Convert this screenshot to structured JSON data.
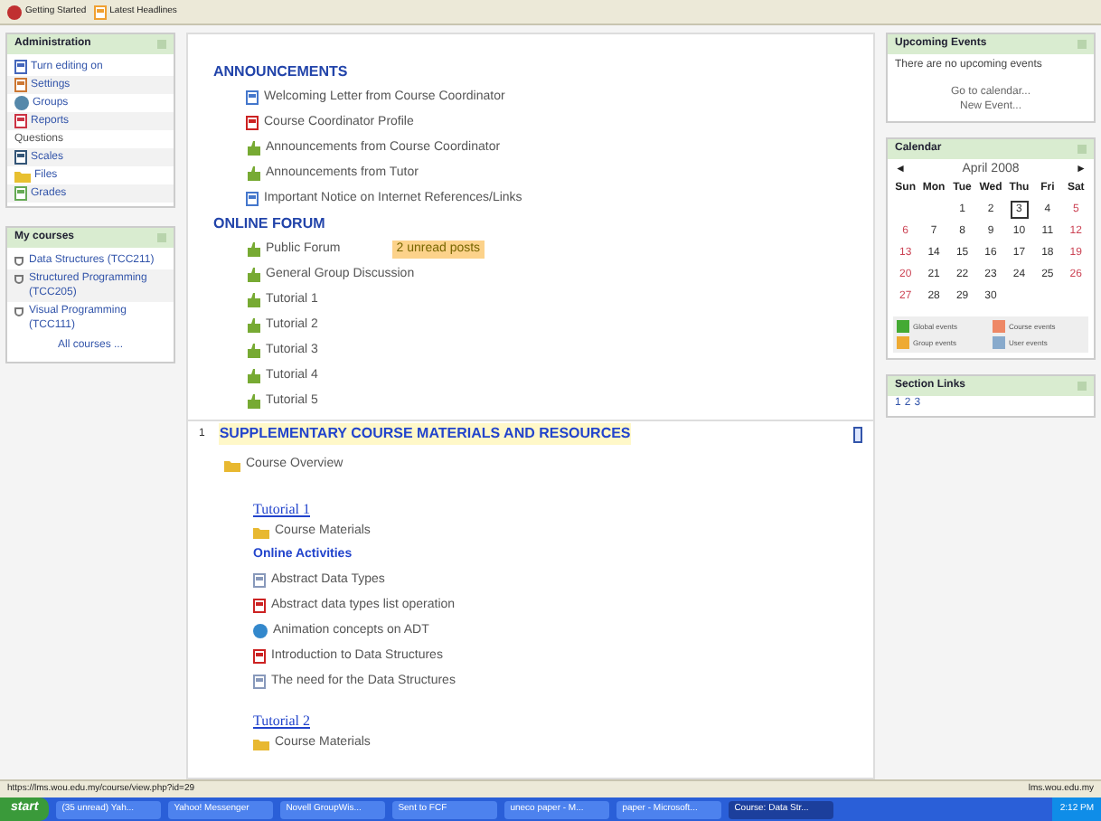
{
  "bookmarks": [
    {
      "label": "Getting Started",
      "kind": "firefox"
    },
    {
      "label": "Latest Headlines",
      "kind": "rss"
    }
  ],
  "administration": {
    "title": "Administration",
    "items": [
      {
        "label": "Turn editing on",
        "kind": "edit"
      },
      {
        "label": "Settings",
        "kind": "settings"
      },
      {
        "label": "Groups",
        "kind": "groups"
      },
      {
        "label": "Reports",
        "kind": "reports"
      },
      {
        "label": "Questions",
        "kind": "plain"
      },
      {
        "label": "Scales",
        "kind": "scales"
      },
      {
        "label": "Files",
        "kind": "files"
      },
      {
        "label": "Grades",
        "kind": "grades"
      }
    ]
  },
  "my_courses": {
    "title": "My courses",
    "items": [
      "Data Structures (TCC211)",
      "Structured Programming (TCC205)",
      "Visual Programming (TCC111)"
    ],
    "all_link": "All courses ..."
  },
  "section0": {
    "groups": [
      {
        "heading": "ANNOUNCEMENTS",
        "items": [
          {
            "label": "Welcoming Letter from Course Coordinator",
            "kind": "page"
          },
          {
            "label": "Course Coordinator Profile",
            "kind": "pdf"
          },
          {
            "label": "Announcements from Course Coordinator",
            "kind": "forum"
          },
          {
            "label": "Announcements from Tutor",
            "kind": "forum"
          },
          {
            "label": "Important Notice on Internet References/Links",
            "kind": "page"
          }
        ]
      },
      {
        "heading": "ONLINE FORUM",
        "items": [
          {
            "label": "Public Forum",
            "kind": "forum",
            "badge": "2 unread posts"
          },
          {
            "label": "General Group Discussion",
            "kind": "forum"
          },
          {
            "label": "Tutorial 1",
            "kind": "forum"
          },
          {
            "label": "Tutorial 2",
            "kind": "forum"
          },
          {
            "label": "Tutorial 3",
            "kind": "forum"
          },
          {
            "label": "Tutorial 4",
            "kind": "forum"
          },
          {
            "label": "Tutorial 5",
            "kind": "forum"
          }
        ]
      }
    ]
  },
  "section1": {
    "number": "1",
    "title": "SUPPLEMENTARY COURSE MATERIALS AND RESOURCES",
    "highlighted": true,
    "overview": {
      "label": "Course Overview",
      "kind": "folder"
    },
    "tutorials": [
      {
        "title": "Tutorial 1",
        "materials": "Course Materials",
        "activities_heading": "Online Activities",
        "activities": [
          {
            "label": "Abstract Data Types",
            "kind": "doc"
          },
          {
            "label": "Abstract data types list operation",
            "kind": "pdf"
          },
          {
            "label": "Animation concepts on ADT",
            "kind": "web"
          },
          {
            "label": "Introduction to Data Structures",
            "kind": "pdf"
          },
          {
            "label": "The need for the Data Structures",
            "kind": "doc"
          }
        ]
      },
      {
        "title": "Tutorial 2",
        "materials": "Course Materials"
      }
    ]
  },
  "upcoming": {
    "title": "Upcoming Events",
    "message": "There are no upcoming events",
    "links": [
      "Go to calendar...",
      "New Event..."
    ]
  },
  "calendar": {
    "title": "Calendar",
    "prev": "◄",
    "month": "April 2008",
    "next": "►",
    "weekdays": [
      "Sun",
      "Mon",
      "Tue",
      "Wed",
      "Thu",
      "Fri",
      "Sat"
    ],
    "weeks": [
      {
        "kind": "partial_start",
        "days": [
          {
            "day": "1",
            "today": false
          },
          {
            "day": "2",
            "today": false
          },
          {
            "day": "3",
            "today": true
          },
          {
            "day": "4",
            "today": false
          },
          {
            "day": "5",
            "today": false
          }
        ]
      },
      {
        "kind": "full",
        "days": [
          {
            "day": "6",
            "today": false
          },
          {
            "day": "7",
            "today": false
          },
          {
            "day": "8",
            "today": false
          },
          {
            "day": "9",
            "today": false
          },
          {
            "day": "10",
            "today": false
          },
          {
            "day": "11",
            "today": false
          },
          {
            "day": "12",
            "today": false
          }
        ]
      },
      {
        "kind": "full",
        "days": [
          {
            "day": "13",
            "today": false
          },
          {
            "day": "14",
            "today": false
          },
          {
            "day": "15",
            "today": false
          },
          {
            "day": "16",
            "today": false
          },
          {
            "day": "17",
            "today": false
          },
          {
            "day": "18",
            "today": false
          },
          {
            "day": "19",
            "today": false
          }
        ]
      },
      {
        "kind": "full",
        "days": [
          {
            "day": "20",
            "today": false
          },
          {
            "day": "21",
            "today": false
          },
          {
            "day": "22",
            "today": false
          },
          {
            "day": "23",
            "today": false
          },
          {
            "day": "24",
            "today": false
          },
          {
            "day": "25",
            "today": false
          },
          {
            "day": "26",
            "today": false
          }
        ]
      },
      {
        "kind": "partial_end",
        "days": [
          {
            "day": "27",
            "today": false
          },
          {
            "day": "28",
            "today": false
          },
          {
            "day": "29",
            "today": false
          },
          {
            "day": "30",
            "today": false
          }
        ]
      }
    ],
    "legend": [
      {
        "label": "Global events",
        "color": "#44aa33"
      },
      {
        "label": "Course events",
        "color": "#ee8866"
      },
      {
        "label": "Group events",
        "color": "#eeaa33"
      },
      {
        "label": "User events",
        "color": "#88aacc"
      }
    ]
  },
  "section_links": {
    "title": "Section Links",
    "links": [
      "1",
      "2",
      "3"
    ]
  },
  "status_bar": {
    "url": "https://lms.wou.edu.my/course/view.php?id=29",
    "host": "lms.wou.edu.my"
  },
  "taskbar": {
    "start": "start",
    "tasks": [
      {
        "label": "(35 unread) Yah...",
        "active": false
      },
      {
        "label": "Yahoo! Messenger",
        "active": false
      },
      {
        "label": "Novell GroupWis...",
        "active": false
      },
      {
        "label": "Sent to FCF",
        "active": false
      },
      {
        "label": "uneco paper - M...",
        "active": false
      },
      {
        "label": "paper - Microsoft...",
        "active": false
      },
      {
        "label": "Course: Data Str...",
        "active": true
      }
    ],
    "clock": "2:12 PM"
  }
}
